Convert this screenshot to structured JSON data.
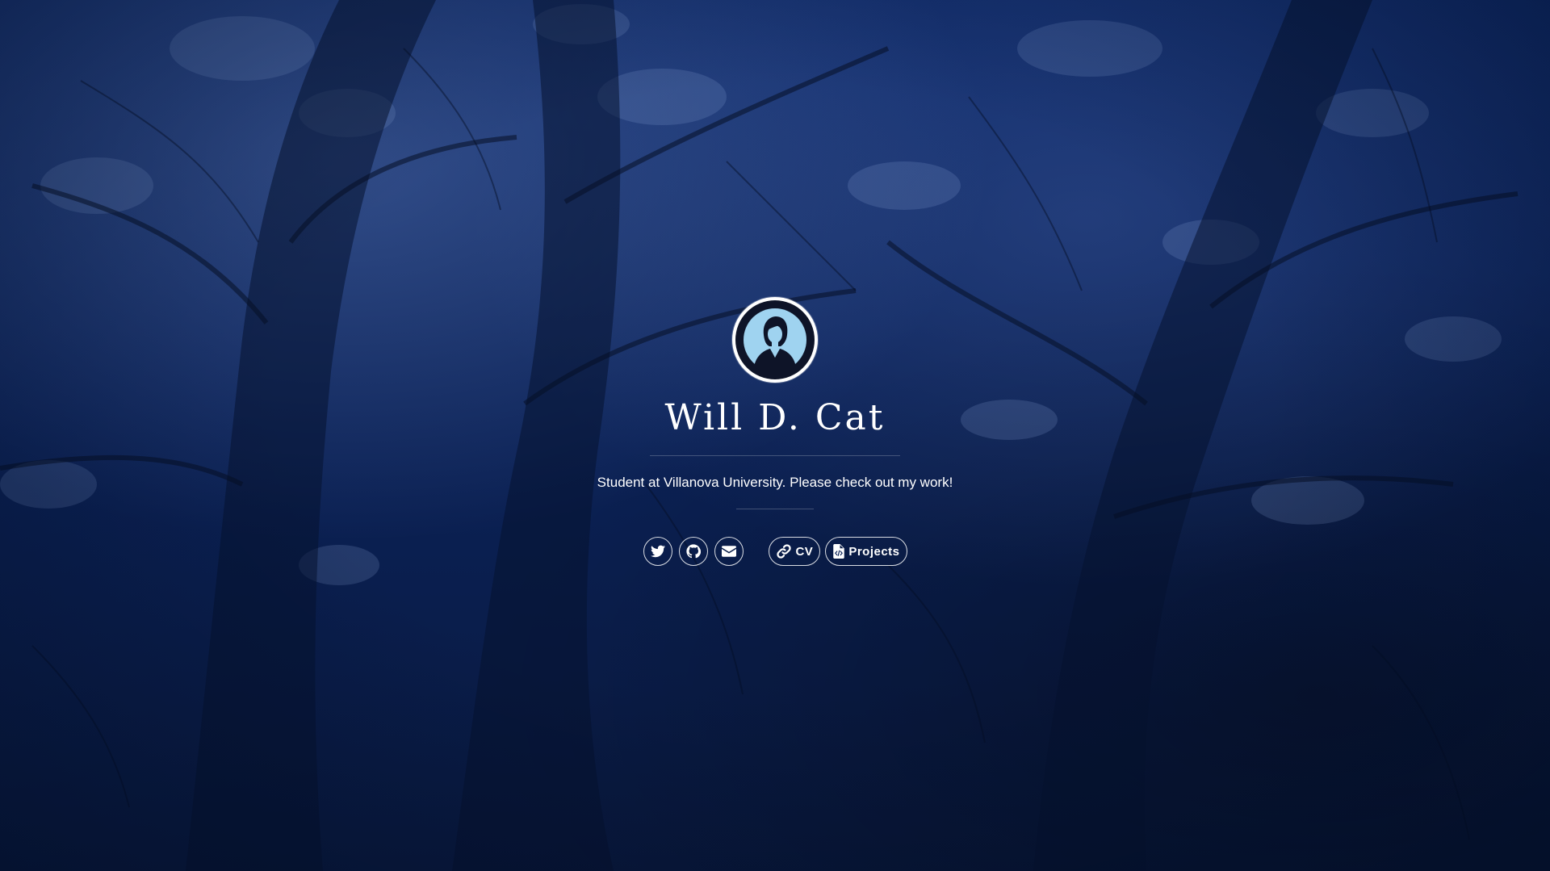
{
  "profile": {
    "name": "Will D. Cat",
    "tagline": "Student at Villanova University. Please check out my work!"
  },
  "social": [
    {
      "icon": "twitter-icon"
    },
    {
      "icon": "github-icon"
    },
    {
      "icon": "envelope-icon"
    }
  ],
  "links": {
    "cv_label": "CV",
    "cv_icon": "link-icon",
    "projects_label": "Projects",
    "projects_icon": "code-file-icon"
  },
  "colors": {
    "background": "#0b2258",
    "avatar_bg": "#0e1428",
    "avatar_figure": "#9fd3f0",
    "text": "#ffffff"
  }
}
